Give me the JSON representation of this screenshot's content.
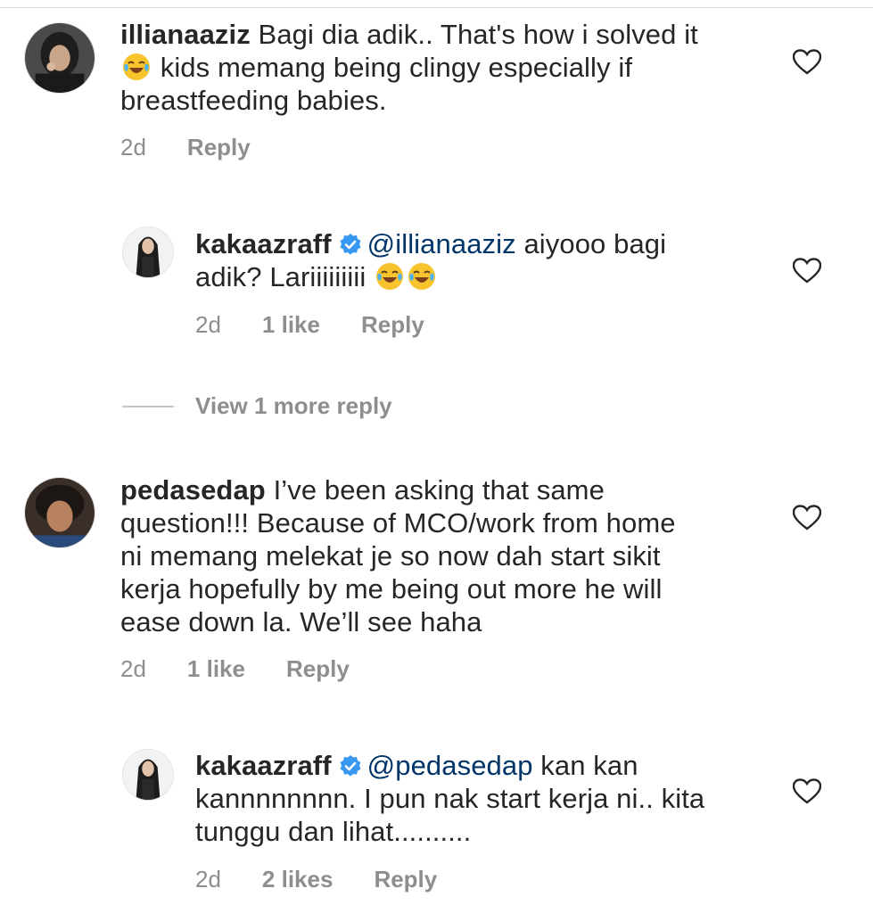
{
  "comments": [
    {
      "username": "illianaaziz",
      "lines": [
        "Bagi dia adik.. That's how i solved it",
        " kids memang being clingy especially if",
        "breastfeeding babies."
      ],
      "time": "2d",
      "reply_label": "Reply"
    },
    {
      "username": "kakaazraff",
      "mention": "@illianaaziz",
      "line1_rest": " aiyooo bagi",
      "line2": "adik? Lariiiiiiiii ",
      "time": "2d",
      "likes": "1 like",
      "reply_label": "Reply"
    },
    {
      "username": "pedasedap",
      "lines": [
        " I’ve been asking that same",
        "question!!! Because of MCO/work from home",
        "ni memang melekat je so now dah start sikit",
        "kerja hopefully by me being out more he will",
        "ease down la. We’ll see haha"
      ],
      "time": "2d",
      "likes": "1 like",
      "reply_label": "Reply"
    },
    {
      "username": "kakaazraff",
      "mention": "@pedasedap",
      "line1_rest": " kan kan",
      "lines_rest": [
        "kannnnnnnn. I pun nak start kerja ni.. kita",
        "tunggu dan lihat.........."
      ],
      "time": "2d",
      "likes": "2 likes",
      "reply_label": "Reply"
    }
  ],
  "view_more_label": "View 1 more reply",
  "icons": {
    "heart": "heart-outline-icon",
    "verified": "verified-badge-icon",
    "emoji": "face-with-tears-of-joy-emoji"
  },
  "colors": {
    "text": "#262626",
    "secondary": "#8e8e8e",
    "mention": "#003569",
    "verified": "#3897f0"
  }
}
